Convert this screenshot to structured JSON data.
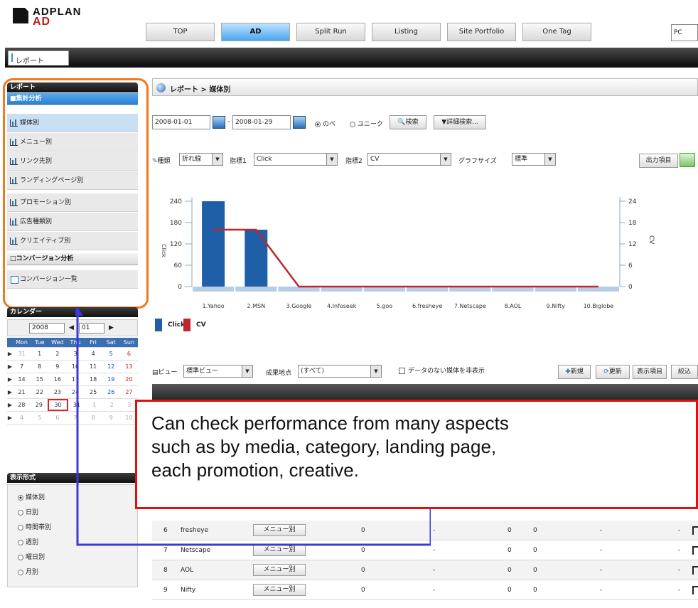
{
  "header": {
    "logo_line1": "ADPLAN",
    "logo_line2": "AD",
    "nav": [
      "TOP",
      "AD",
      "Split Run",
      "Listing",
      "Site Portfolio",
      "One Tag"
    ],
    "active_nav": "AD",
    "right_field": "PC",
    "tab_label": "レポート"
  },
  "sidebar": {
    "report_title": "レポート",
    "section1_title": "■集計分析",
    "items": [
      "媒体別",
      "メニュー別",
      "リンク先別",
      "ランディングページ別",
      "プロモーション別",
      "広告種類別",
      "クリエイティブ別"
    ],
    "section2_title": "□コンバージョン分析",
    "conversion_item": "コンバージョン一覧",
    "calendar_title": "カレンダー",
    "calendar_year": "2008",
    "calendar_month": "01",
    "calendar_weekdays": [
      "Mon",
      "Tue",
      "Wed",
      "Thu",
      "Fri",
      "Sat",
      "Sun"
    ],
    "calendar_weeks": [
      [
        "31",
        "1",
        "2",
        "3",
        "4",
        "5",
        "6"
      ],
      [
        "7",
        "8",
        "9",
        "10",
        "11",
        "12",
        "13"
      ],
      [
        "14",
        "15",
        "16",
        "17",
        "18",
        "19",
        "20"
      ],
      [
        "21",
        "22",
        "23",
        "24",
        "25",
        "26",
        "27"
      ],
      [
        "28",
        "29",
        "30",
        "31",
        "1",
        "2",
        "3"
      ],
      [
        "4",
        "5",
        "6",
        "7",
        "8",
        "9",
        "10"
      ]
    ],
    "today": "30",
    "format_title": "表示形式",
    "format_options": [
      "媒体別",
      "日別",
      "時間帯別",
      "週別",
      "曜日別",
      "月別"
    ],
    "format_selected": "媒体別"
  },
  "main": {
    "breadcrumb": "レポート > 媒体別",
    "date_from": "2008-01-01",
    "date_to": "2008-01-29",
    "date_sep": "-",
    "radio_all": "のべ",
    "radio_unique": "ユニーク",
    "search_button": "検索",
    "detail_button": "詳細検索...",
    "graph_type_label": "種類",
    "graph_type": "折れ線",
    "index1_label": "指標1",
    "index1": "Click",
    "index2_label": "指標2",
    "index2": "CV",
    "graph_size_label": "グラフサイズ",
    "graph_size": "標準",
    "export_button": "出力項目",
    "view_label": "ビュー",
    "view_value": "標準ビュー",
    "result_label": "成果地点",
    "result_value": "(すべて)",
    "hide_empty_label": "データのない媒体を非表示",
    "new_button": "新規",
    "refresh_button": "更新",
    "display_items_button": "表示項目",
    "filter_button": "絞込",
    "legend_click": "Click",
    "legend_cv": "CV",
    "table_rows": [
      {
        "no": "6",
        "name": "fresheye",
        "menu": "メニュー別",
        "c1": "0",
        "c2": "-",
        "c3": "0",
        "c4": "0",
        "c5": "-",
        "c6": "-"
      },
      {
        "no": "7",
        "name": "Netscape",
        "menu": "メニュー別",
        "c1": "0",
        "c2": "-",
        "c3": "0",
        "c4": "0",
        "c5": "-",
        "c6": "-"
      },
      {
        "no": "8",
        "name": "AOL",
        "menu": "メニュー別",
        "c1": "0",
        "c2": "-",
        "c3": "0",
        "c4": "0",
        "c5": "-",
        "c6": "-"
      },
      {
        "no": "9",
        "name": "Nifty",
        "menu": "メニュー別",
        "c1": "0",
        "c2": "-",
        "c3": "0",
        "c4": "0",
        "c5": "-",
        "c6": "-"
      }
    ]
  },
  "chart_data": {
    "type": "bar",
    "categories": [
      "1.Yahoo",
      "2.MSN",
      "3.Google",
      "4.Infoseek",
      "5.goo",
      "6.fresheye",
      "7.Netscape",
      "8.AOL",
      "9.Nifty",
      "10.Biglobe"
    ],
    "series": [
      {
        "name": "Click",
        "type": "bar",
        "axis": "left",
        "color": "#1f5fa8",
        "values": [
          240,
          160,
          0,
          0,
          0,
          0,
          0,
          0,
          0,
          0
        ]
      },
      {
        "name": "CV",
        "type": "line",
        "axis": "right",
        "color": "#c0262c",
        "values": [
          16,
          16,
          0,
          0,
          0,
          0,
          0,
          0,
          0,
          0
        ]
      }
    ],
    "y_left_ticks": [
      "0",
      "60",
      "120",
      "180",
      "240"
    ],
    "y_right_ticks": [
      "0",
      "6",
      "12",
      "18",
      "24"
    ],
    "ylim_left": [
      0,
      240
    ],
    "ylim_right": [
      0,
      24
    ],
    "ylabel_left": "Click",
    "ylabel_right": "CV",
    "grid": false,
    "legend_position": "bottom-left"
  },
  "callout": {
    "line1": "Can check performance from many aspects",
    "line2": "such as by media, category, landing page,",
    "line3": "each promotion, creative."
  },
  "colors": {
    "accent_blue": "#2c6fb6",
    "highlight_orange": "#f07a1c",
    "callout_red": "#e01010",
    "connector_blue": "#3a3adb"
  }
}
